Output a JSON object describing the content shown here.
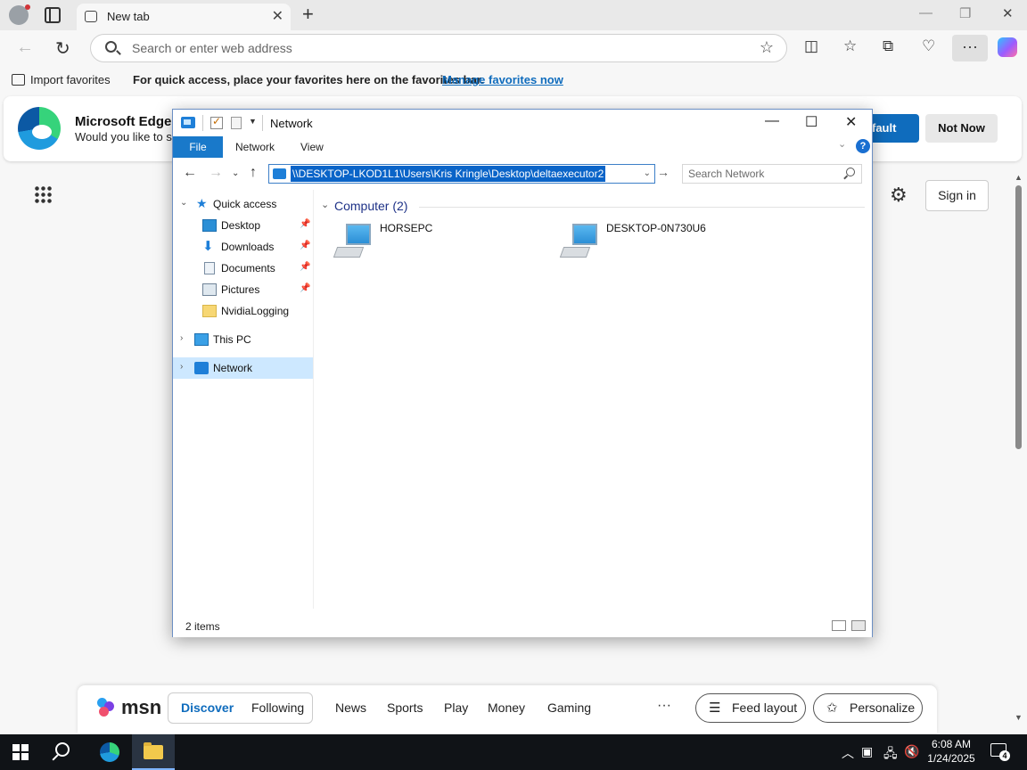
{
  "browser": {
    "tab_title": "New tab",
    "address_placeholder": "Search or enter web address",
    "favorites_bar": {
      "import_label": "Import favorites",
      "message": "For quick access, place your favorites here on the favorites bar.",
      "manage_link": "Manage favorites now"
    },
    "banner": {
      "title": "Microsoft Edge",
      "text": "Would you like to se",
      "primary_button": "fault",
      "secondary_button": "Not Now"
    },
    "signin_label": "Sign in",
    "msn": {
      "logo_text": "msn",
      "tabs": [
        "Discover",
        "Following",
        "News",
        "Sports",
        "Play",
        "Money",
        "Gaming"
      ],
      "more": "···",
      "feed_layout": "Feed layout",
      "personalize": "Personalize"
    }
  },
  "explorer": {
    "title": "Network",
    "ribbon_tabs": [
      "File",
      "Network",
      "View"
    ],
    "address_path": "\\\\DESKTOP-LKOD1L1\\Users\\Kris Kringle\\Desktop\\deltaexecutor2",
    "search_placeholder": "Search Network",
    "tree": {
      "quick_access": "Quick access",
      "items": [
        "Desktop",
        "Downloads",
        "Documents",
        "Pictures",
        "NvidiaLogging"
      ],
      "this_pc": "This PC",
      "network": "Network"
    },
    "group_header": "Computer (2)",
    "computers": [
      "HORSEPC",
      "DESKTOP-0N730U6"
    ],
    "status": "2 items"
  },
  "taskbar": {
    "time": "6:08 AM",
    "date": "1/24/2025",
    "notification_count": "4"
  },
  "colors": {
    "accent": "#0f6cbd",
    "explorer_file_tab": "#1979ca",
    "selection": "#0a64c8",
    "taskbar": "#101317"
  },
  "icons": [
    "search-icon",
    "star-icon",
    "split-screen-icon",
    "favorites-icon",
    "collections-icon",
    "health-icon",
    "more-icon",
    "copilot-icon",
    "apps-grid-icon",
    "gear-icon",
    "pc-icon",
    "network-icon",
    "folder-icon",
    "pin-icon"
  ]
}
